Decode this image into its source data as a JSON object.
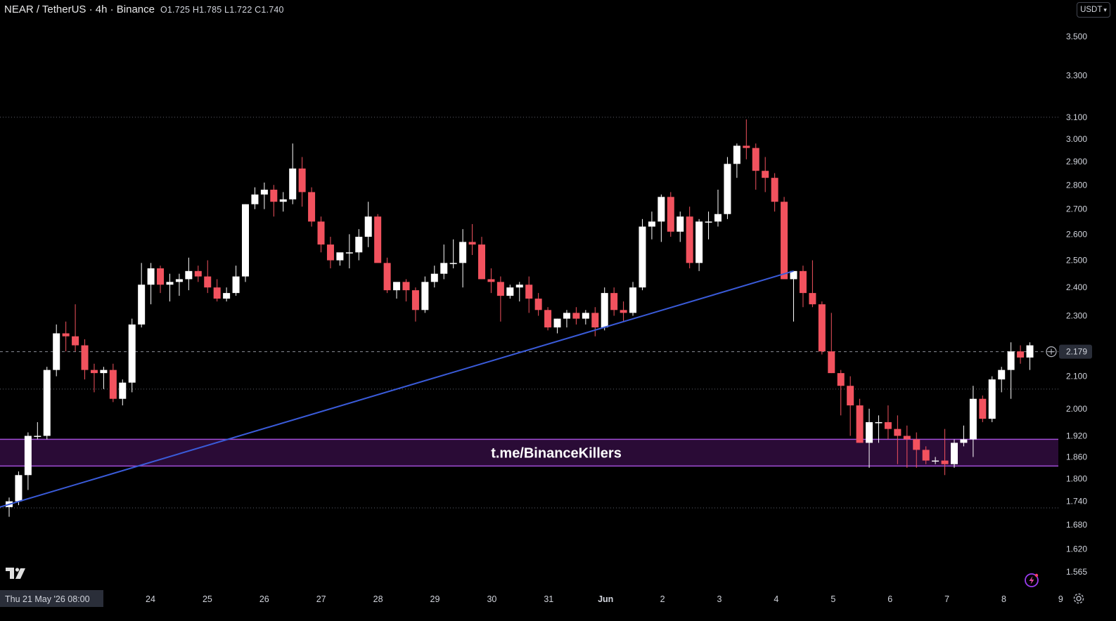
{
  "header": {
    "symbol": "NEAR / TetherUS · 4h · Binance",
    "ohlc": "O1.725  H1.785  L1.722  C1.740"
  },
  "currency_selector": "USDT",
  "watermark_text": "t.me/BinanceKillers",
  "crosshair_date": "Thu 21 May '26   08:00",
  "current_price_label": "2.179",
  "icons": [
    "tradingview-logo-icon",
    "lightning-icon",
    "gear-icon",
    "add-alert-icon",
    "chevron-down-icon"
  ],
  "colors": {
    "background": "#000000",
    "up": "#ffffff",
    "down": "#f2525e",
    "trendline": "#3a5bd9",
    "zone_fill": "#2a0b36",
    "zone_border": "#a24ed6"
  },
  "chart_data": {
    "type": "candlestick",
    "symbol": "NEARUSDT",
    "timeframe": "4h",
    "y_scale": "log",
    "y_ticks": [
      "3.500",
      "3.300",
      "3.100",
      "3.000",
      "2.900",
      "2.800",
      "2.700",
      "2.600",
      "2.500",
      "2.400",
      "2.300",
      "2.100",
      "2.000",
      "1.920",
      "1.860",
      "1.800",
      "1.740",
      "1.680",
      "1.620",
      "1.565"
    ],
    "x_ticks": [
      "24",
      "25",
      "26",
      "27",
      "28",
      "29",
      "30",
      "31",
      "Jun",
      "2",
      "3",
      "4",
      "5",
      "6",
      "7",
      "8",
      "9"
    ],
    "horizontal_levels": [
      3.1,
      2.06,
      1.723
    ],
    "current_price": 2.179,
    "zone": {
      "low": 1.835,
      "high": 1.91,
      "label": "t.me/BinanceKillers"
    },
    "trendline": [
      {
        "candle_index": 0,
        "price": 1.725
      },
      {
        "candle_index": 83,
        "price": 2.46
      }
    ],
    "candles": [
      [
        1.725,
        1.75,
        1.7,
        1.74
      ],
      [
        1.74,
        1.82,
        1.73,
        1.81
      ],
      [
        1.81,
        1.93,
        1.77,
        1.92
      ],
      [
        1.92,
        1.96,
        1.91,
        1.92
      ],
      [
        1.92,
        2.13,
        1.91,
        2.12
      ],
      [
        2.12,
        2.27,
        2.1,
        2.24
      ],
      [
        2.24,
        2.28,
        2.18,
        2.23
      ],
      [
        2.23,
        2.34,
        2.18,
        2.2
      ],
      [
        2.2,
        2.22,
        2.09,
        2.12
      ],
      [
        2.12,
        2.14,
        2.05,
        2.11
      ],
      [
        2.11,
        2.13,
        2.06,
        2.12
      ],
      [
        2.12,
        2.14,
        2.02,
        2.03
      ],
      [
        2.03,
        2.09,
        2.01,
        2.08
      ],
      [
        2.08,
        2.29,
        2.05,
        2.27
      ],
      [
        2.27,
        2.49,
        2.26,
        2.41
      ],
      [
        2.41,
        2.49,
        2.34,
        2.47
      ],
      [
        2.47,
        2.48,
        2.38,
        2.41
      ],
      [
        2.41,
        2.45,
        2.35,
        2.42
      ],
      [
        2.42,
        2.45,
        2.37,
        2.43
      ],
      [
        2.43,
        2.51,
        2.39,
        2.46
      ],
      [
        2.46,
        2.48,
        2.42,
        2.44
      ],
      [
        2.44,
        2.5,
        2.38,
        2.4
      ],
      [
        2.4,
        2.43,
        2.35,
        2.36
      ],
      [
        2.36,
        2.4,
        2.35,
        2.38
      ],
      [
        2.38,
        2.48,
        2.37,
        2.44
      ],
      [
        2.44,
        2.72,
        2.42,
        2.72
      ],
      [
        2.72,
        2.79,
        2.7,
        2.76
      ],
      [
        2.76,
        2.81,
        2.7,
        2.78
      ],
      [
        2.78,
        2.8,
        2.67,
        2.73
      ],
      [
        2.73,
        2.77,
        2.69,
        2.74
      ],
      [
        2.74,
        2.98,
        2.72,
        2.87
      ],
      [
        2.87,
        2.92,
        2.71,
        2.77
      ],
      [
        2.77,
        2.79,
        2.63,
        2.65
      ],
      [
        2.65,
        2.67,
        2.53,
        2.56
      ],
      [
        2.56,
        2.59,
        2.47,
        2.5
      ],
      [
        2.5,
        2.52,
        2.48,
        2.53
      ],
      [
        2.53,
        2.6,
        2.47,
        2.53
      ],
      [
        2.53,
        2.62,
        2.5,
        2.59
      ],
      [
        2.59,
        2.73,
        2.55,
        2.67
      ],
      [
        2.67,
        2.68,
        2.5,
        2.49
      ],
      [
        2.49,
        2.51,
        2.38,
        2.39
      ],
      [
        2.39,
        2.41,
        2.36,
        2.42
      ],
      [
        2.42,
        2.43,
        2.35,
        2.39
      ],
      [
        2.39,
        2.4,
        2.28,
        2.32
      ],
      [
        2.32,
        2.44,
        2.31,
        2.42
      ],
      [
        2.42,
        2.48,
        2.4,
        2.45
      ],
      [
        2.45,
        2.56,
        2.43,
        2.49
      ],
      [
        2.49,
        2.58,
        2.47,
        2.49
      ],
      [
        2.49,
        2.62,
        2.4,
        2.57
      ],
      [
        2.57,
        2.64,
        2.52,
        2.56
      ],
      [
        2.56,
        2.59,
        2.43,
        2.43
      ],
      [
        2.43,
        2.47,
        2.38,
        2.42
      ],
      [
        2.42,
        2.44,
        2.28,
        2.37
      ],
      [
        2.37,
        2.41,
        2.36,
        2.4
      ],
      [
        2.4,
        2.42,
        2.35,
        2.41
      ],
      [
        2.41,
        2.44,
        2.31,
        2.36
      ],
      [
        2.36,
        2.38,
        2.3,
        2.32
      ],
      [
        2.32,
        2.33,
        2.25,
        2.26
      ],
      [
        2.26,
        2.29,
        2.24,
        2.29
      ],
      [
        2.29,
        2.32,
        2.26,
        2.31
      ],
      [
        2.31,
        2.33,
        2.27,
        2.29
      ],
      [
        2.29,
        2.32,
        2.27,
        2.31
      ],
      [
        2.31,
        2.33,
        2.23,
        2.26
      ],
      [
        2.26,
        2.4,
        2.25,
        2.38
      ],
      [
        2.38,
        2.4,
        2.3,
        2.32
      ],
      [
        2.32,
        2.35,
        2.28,
        2.31
      ],
      [
        2.31,
        2.42,
        2.3,
        2.4
      ],
      [
        2.4,
        2.66,
        2.39,
        2.63
      ],
      [
        2.63,
        2.69,
        2.58,
        2.65
      ],
      [
        2.65,
        2.76,
        2.57,
        2.75
      ],
      [
        2.75,
        2.77,
        2.59,
        2.61
      ],
      [
        2.61,
        2.69,
        2.57,
        2.67
      ],
      [
        2.67,
        2.71,
        2.47,
        2.49
      ],
      [
        2.49,
        2.66,
        2.46,
        2.65
      ],
      [
        2.65,
        2.69,
        2.58,
        2.65
      ],
      [
        2.65,
        2.78,
        2.63,
        2.68
      ],
      [
        2.68,
        2.92,
        2.66,
        2.89
      ],
      [
        2.89,
        2.98,
        2.83,
        2.97
      ],
      [
        2.97,
        3.09,
        2.91,
        2.96
      ],
      [
        2.96,
        2.98,
        2.78,
        2.86
      ],
      [
        2.86,
        2.92,
        2.77,
        2.83
      ],
      [
        2.83,
        2.85,
        2.69,
        2.73
      ],
      [
        2.73,
        2.75,
        2.44,
        2.43
      ],
      [
        2.43,
        2.46,
        2.28,
        2.46
      ],
      [
        2.46,
        2.48,
        2.33,
        2.38
      ],
      [
        2.38,
        2.5,
        2.33,
        2.34
      ],
      [
        2.34,
        2.35,
        2.17,
        2.18
      ],
      [
        2.18,
        2.31,
        2.11,
        2.11
      ],
      [
        2.11,
        2.12,
        1.98,
        2.07
      ],
      [
        2.07,
        2.1,
        1.92,
        2.01
      ],
      [
        2.01,
        2.03,
        1.9,
        1.9
      ],
      [
        1.9,
        2.0,
        1.83,
        1.96
      ],
      [
        1.96,
        1.98,
        1.9,
        1.96
      ],
      [
        1.96,
        2.01,
        1.91,
        1.94
      ],
      [
        1.94,
        1.98,
        1.84,
        1.92
      ],
      [
        1.92,
        1.95,
        1.83,
        1.91
      ],
      [
        1.91,
        1.93,
        1.83,
        1.88
      ],
      [
        1.88,
        1.89,
        1.84,
        1.85
      ],
      [
        1.85,
        1.86,
        1.84,
        1.85
      ],
      [
        1.85,
        1.94,
        1.81,
        1.84
      ],
      [
        1.84,
        1.91,
        1.83,
        1.9
      ],
      [
        1.9,
        1.95,
        1.89,
        1.91
      ],
      [
        1.91,
        2.07,
        1.86,
        2.03
      ],
      [
        2.03,
        2.04,
        1.96,
        1.97
      ],
      [
        1.97,
        2.1,
        1.96,
        2.09
      ],
      [
        2.09,
        2.13,
        2.05,
        2.12
      ],
      [
        2.12,
        2.21,
        2.03,
        2.18
      ],
      [
        2.18,
        2.2,
        2.14,
        2.16
      ],
      [
        2.16,
        2.21,
        2.12,
        2.2
      ]
    ]
  }
}
